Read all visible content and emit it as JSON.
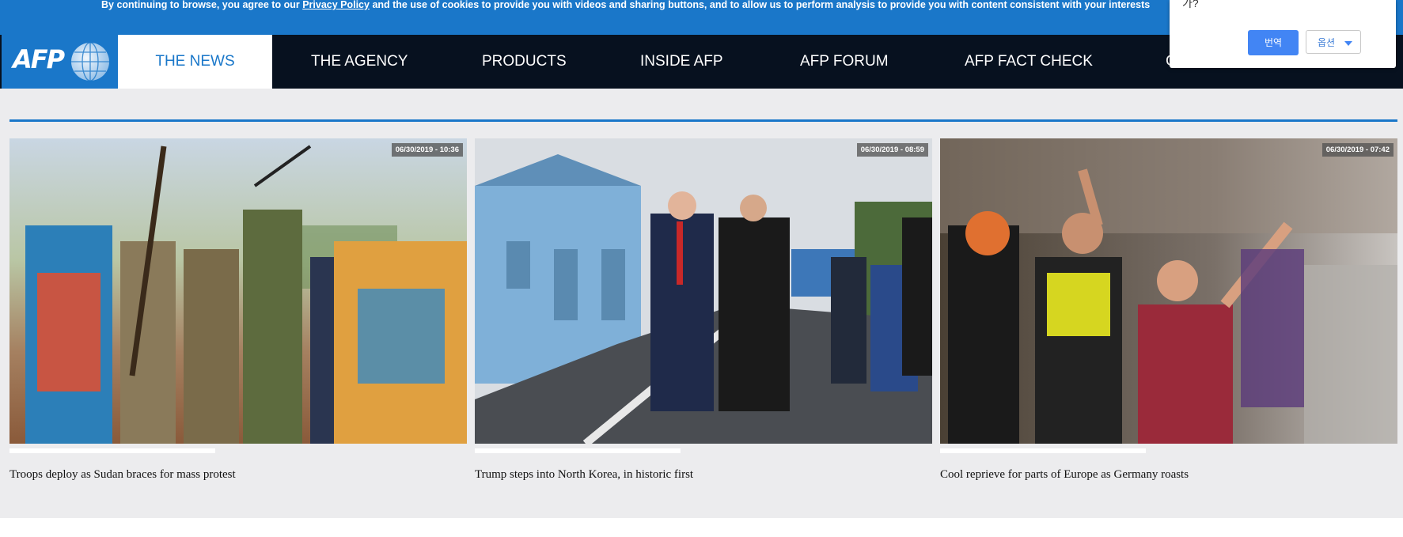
{
  "cookie_notice": {
    "prefix": "By continuing to browse, you agree to our ",
    "link": "Privacy Policy",
    "suffix": " and the use of cookies to provide you with videos and sharing buttons, and to allow us to perform analysis to provide you with content consistent with your interests"
  },
  "logo": {
    "text": "AFP"
  },
  "nav": {
    "items": [
      {
        "label": "THE NEWS",
        "active": true
      },
      {
        "label": "THE AGENCY"
      },
      {
        "label": "PRODUCTS"
      },
      {
        "label": "INSIDE AFP"
      },
      {
        "label": "AFP FORUM"
      },
      {
        "label": "AFP FACT CHECK"
      },
      {
        "label": "C"
      }
    ]
  },
  "translate_popup": {
    "question": "가?",
    "translate_button": "번역",
    "options_button": "옵션"
  },
  "cards": [
    {
      "timestamp": "06/30/2019 - 10:36",
      "caption": "Troops deploy as Sudan braces for mass protest"
    },
    {
      "timestamp": "06/30/2019 - 08:59",
      "caption": "Trump steps into North Korea, in historic first"
    },
    {
      "timestamp": "06/30/2019 - 07:42",
      "caption": "Cool reprieve for parts of Europe as Germany roasts"
    }
  ],
  "colors": {
    "brand_blue": "#1a77c9",
    "nav_dark": "#07111f",
    "content_bg": "#ececee",
    "translate_blue": "#4285f4"
  }
}
